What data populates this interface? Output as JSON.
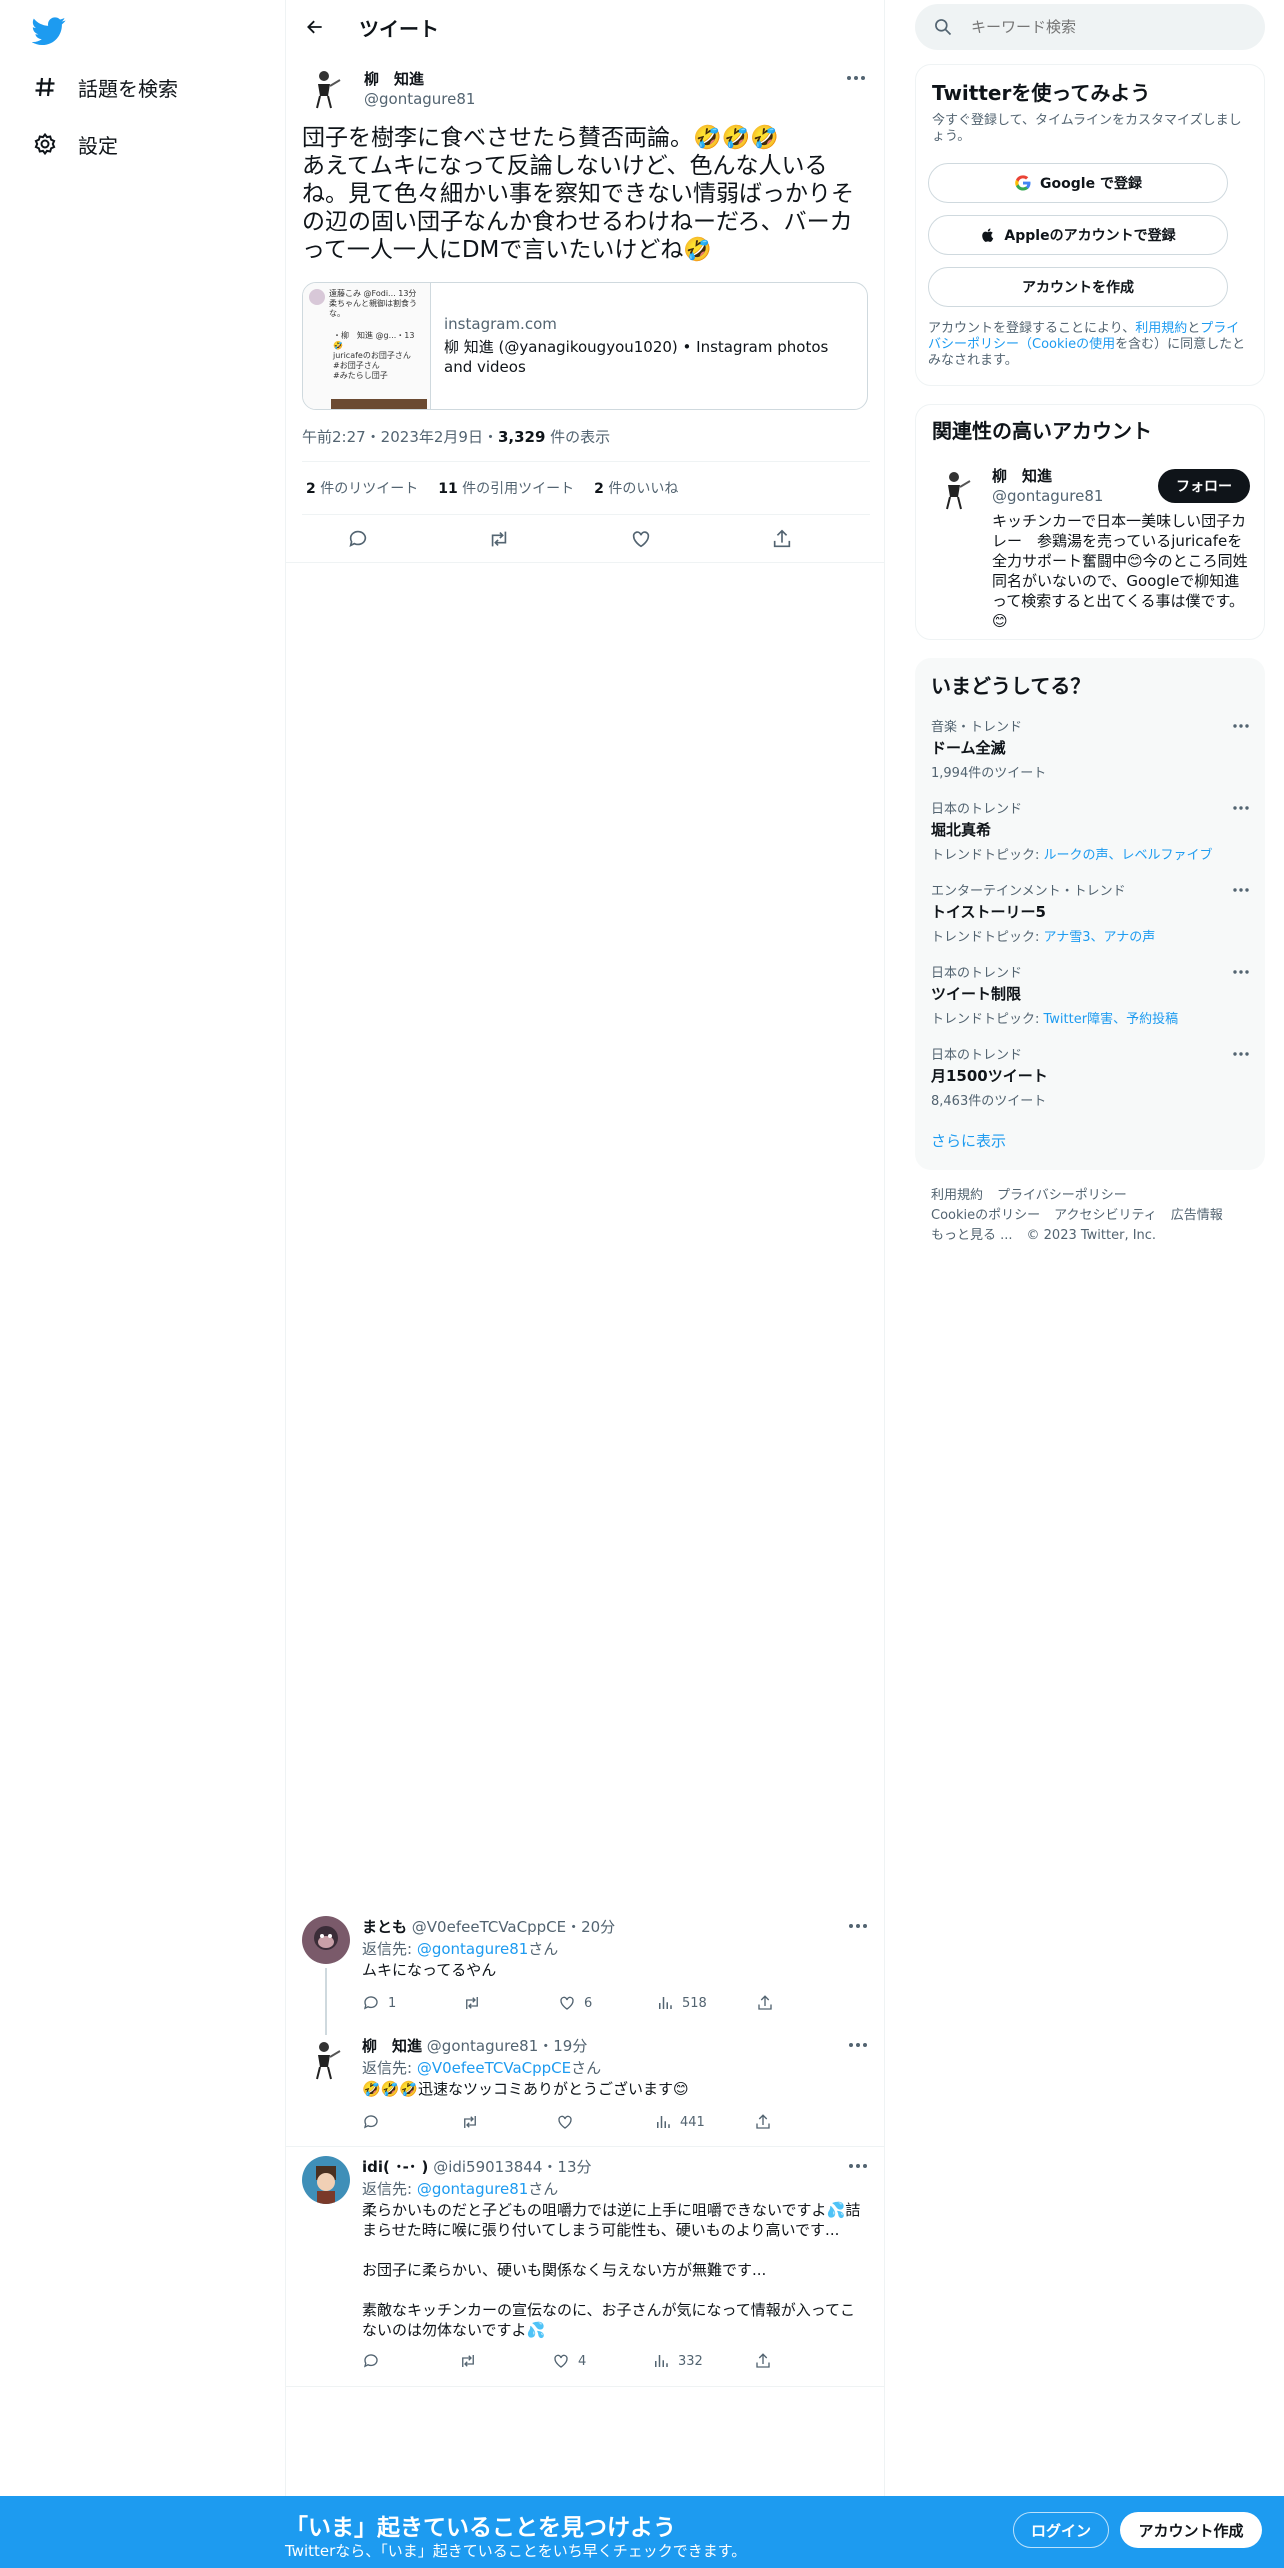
{
  "nav": {
    "explore_label": "話題を検索",
    "settings_label": "設定"
  },
  "header": {
    "title": "ツイート"
  },
  "tweet": {
    "author_name": "柳　知進",
    "author_handle": "@gontagure81",
    "text": "団子を樹李に食べさせたら賛否両論。🤣🤣🤣\nあえてムキになって反論しないけど、色んな人いるね。見て色々細かい事を察知できない情弱ばっかりその辺の固い団子なんか食わせるわけねーだろ、バーカって一人一人にDMで言いたいけどね🤣",
    "card": {
      "domain": "instagram.com",
      "title": "柳 知進 (@yanagikougyou1020) • Instagram photos and videos",
      "thumb_lines": [
        "遠藤こみ @Fodi... 13分",
        "柔ちゃんと親御は割食う",
        "な。",
        "・柳　知進 @g...・13",
        "🤣",
        "juricafeのお団子さん",
        "#お団子さん",
        "#みたらし団子"
      ]
    },
    "time": "午前2:27・2023年2月9日・",
    "views_count": "3,329",
    "views_label": " 件の表示",
    "retweets_count": "2",
    "retweets_label": " 件のリツイート",
    "quotes_count": "11",
    "quotes_label": " 件の引用ツイート",
    "likes_count": "2",
    "likes_label": " 件のいいね"
  },
  "replies": [
    {
      "name": "まとも",
      "handle": "@V0efeeTCVaCppCE",
      "time": "・20分",
      "reply_prefix": "返信先: ",
      "reply_to": "@gontagure81",
      "reply_suffix": "さん",
      "text": "ムキになってるやん",
      "replies": "1",
      "retweets": "",
      "likes": "6",
      "views": "518"
    },
    {
      "name": "柳　知進",
      "handle": "@gontagure81",
      "time": "・19分",
      "reply_prefix": "返信先: ",
      "reply_to": "@V0efeeTCVaCppCE",
      "reply_suffix": "さん",
      "text": "🤣🤣🤣迅速なツッコミありがとうございます😊",
      "replies": "",
      "retweets": "",
      "likes": "",
      "views": "441"
    },
    {
      "name": "idi( ･-･ )",
      "handle": "@idi59013844",
      "time": "・13分",
      "reply_prefix": "返信先: ",
      "reply_to": "@gontagure81",
      "reply_suffix": "さん",
      "text": "柔らかいものだと子どもの咀嚼力では逆に上手に咀嚼できないですよ💦詰まらせた時に喉に張り付いてしまう可能性も、硬いものより高いです...\n\nお団子に柔らかい、硬いも関係なく与えない方が無難です...\n\n素敵なキッチンカーの宣伝なのに、お子さんが気になって情報が入ってこないのは勿体ないですよ💦",
      "replies": "",
      "retweets": "",
      "likes": "4",
      "views": "332"
    }
  ],
  "search": {
    "placeholder": "キーワード検索"
  },
  "signup": {
    "title": "Twitterを使ってみよう",
    "subtitle": "今すぐ登録して、タイムラインをカスタマイズしましょう。",
    "google_label": "Google で登録",
    "apple_label": "Appleのアカウントで登録",
    "create_label": "アカウントを作成",
    "legal_pre": "アカウントを登録することにより、",
    "legal_terms": "利用規約",
    "legal_and": "と",
    "legal_privacy": "プライバシーポリシー（Cookieの使用",
    "legal_post": "を含む）に同意したとみなされます。"
  },
  "related": {
    "title": "関連性の高いアカウント",
    "name": "柳　知進",
    "handle": "@gontagure81",
    "follow_label": "フォロー",
    "bio": "キッチンカーで日本一美味しい団子カレー　参鶏湯を売っているjuricafeを全力サポート奮闘中😊今のところ同姓同名がいないので、Googleで柳知進って検索すると出てくる事は僕です。😊"
  },
  "trends": {
    "title": "いまどうしてる？",
    "items": [
      {
        "context": "音楽・トレンド",
        "name": "ドーム全滅",
        "sub_pre": "1,994件のツイート",
        "sub_links": ""
      },
      {
        "context": "日本のトレンド",
        "name": "堀北真希",
        "sub_pre": "トレンドトピック: ",
        "sub_links": "ルークの声、レベルファイブ"
      },
      {
        "context": "エンターテインメント・トレンド",
        "name": "トイストーリー5",
        "sub_pre": "トレンドトピック: ",
        "sub_links": "アナ雪3、アナの声"
      },
      {
        "context": "日本のトレンド",
        "name": "ツイート制限",
        "sub_pre": "トレンドトピック: ",
        "sub_links": "Twitter障害、予約投稿"
      },
      {
        "context": "日本のトレンド",
        "name": "月1500ツイート",
        "sub_pre": "8,463件のツイート",
        "sub_links": ""
      }
    ],
    "show_more": "さらに表示"
  },
  "footer": {
    "links": [
      "利用規約",
      "プライバシーポリシー",
      "Cookieのポリシー",
      "アクセシビリティ",
      "広告情報",
      "もっと見る ...",
      "© 2023 Twitter, Inc."
    ]
  },
  "bottom_bar": {
    "title": "「いま」起きていることを見つけよう",
    "subtitle": "Twitterなら、「いま」起きていることをいち早くチェックできます。",
    "login_label": "ログイン",
    "create_label": "アカウント作成"
  },
  "colors": {
    "accent": "#1d9bf0",
    "text": "#0f1419",
    "muted": "#536471",
    "border": "#eff3f4"
  }
}
